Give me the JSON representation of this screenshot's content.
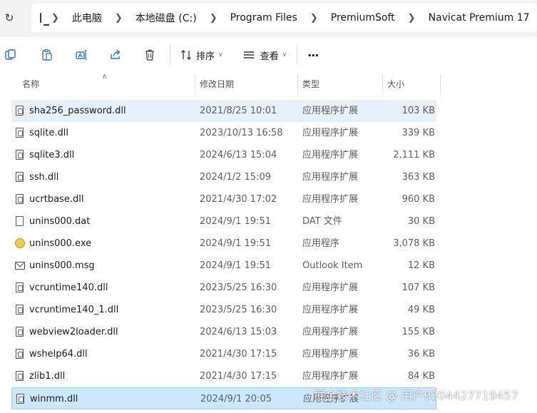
{
  "address_bar": {
    "breadcrumbs": [
      "此电脑",
      "本地磁盘 (C:)",
      "Program Files",
      "PremiumSoft",
      "Navicat Premium 17"
    ]
  },
  "toolbar": {
    "sort_label": "排序",
    "view_label": "查看",
    "more_label": "···"
  },
  "columns": {
    "name": "名称",
    "date": "修改日期",
    "type": "类型",
    "size": "大小"
  },
  "files": [
    {
      "name": "sha256_password.dll",
      "date": "2021/8/25 10:01",
      "type": "应用程序扩展",
      "size": "103 KB",
      "icon": "dll-file-icon",
      "state": "selected"
    },
    {
      "name": "sqlite.dll",
      "date": "2023/10/13 16:58",
      "type": "应用程序扩展",
      "size": "339 KB",
      "icon": "dll-file-icon",
      "state": ""
    },
    {
      "name": "sqlite3.dll",
      "date": "2024/6/13 15:04",
      "type": "应用程序扩展",
      "size": "2,111 KB",
      "icon": "dll-file-icon",
      "state": ""
    },
    {
      "name": "ssh.dll",
      "date": "2024/1/2 15:09",
      "type": "应用程序扩展",
      "size": "363 KB",
      "icon": "dll-file-icon",
      "state": ""
    },
    {
      "name": "ucrtbase.dll",
      "date": "2021/4/30 17:02",
      "type": "应用程序扩展",
      "size": "960 KB",
      "icon": "dll-file-icon",
      "state": ""
    },
    {
      "name": "unins000.dat",
      "date": "2024/9/1 19:51",
      "type": "DAT 文件",
      "size": "30 KB",
      "icon": "blank-file-icon",
      "state": ""
    },
    {
      "name": "unins000.exe",
      "date": "2024/9/1 19:51",
      "type": "应用程序",
      "size": "3,078 KB",
      "icon": "installer-icon",
      "state": ""
    },
    {
      "name": "unins000.msg",
      "date": "2024/9/1 19:51",
      "type": "Outlook Item",
      "size": "12 KB",
      "icon": "mail-icon",
      "state": ""
    },
    {
      "name": "vcruntime140.dll",
      "date": "2023/5/25 16:30",
      "type": "应用程序扩展",
      "size": "107 KB",
      "icon": "dll-file-icon",
      "state": ""
    },
    {
      "name": "vcruntime140_1.dll",
      "date": "2023/5/25 16:30",
      "type": "应用程序扩展",
      "size": "49 KB",
      "icon": "dll-file-icon",
      "state": ""
    },
    {
      "name": "webview2loader.dll",
      "date": "2024/6/13 15:03",
      "type": "应用程序扩展",
      "size": "155 KB",
      "icon": "dll-file-icon",
      "state": ""
    },
    {
      "name": "wshelp64.dll",
      "date": "2021/4/30 17:15",
      "type": "应用程序扩展",
      "size": "36 KB",
      "icon": "dll-file-icon",
      "state": ""
    },
    {
      "name": "zlib1.dll",
      "date": "2021/4/30 17:15",
      "type": "应用程序扩展",
      "size": "84 KB",
      "icon": "dll-file-icon",
      "state": ""
    },
    {
      "name": "winmm.dll",
      "date": "2024/9/1 20:05",
      "type": "应用程序扩展",
      "size": "",
      "icon": "dll-file-icon",
      "state": "focused"
    }
  ],
  "watermark": "掘金技术社区 @ 用户9204427719457",
  "colors": {
    "selected_row": "#e5f1fb",
    "focused_row": "#cce8ff",
    "accent": "#2a6fc9"
  }
}
